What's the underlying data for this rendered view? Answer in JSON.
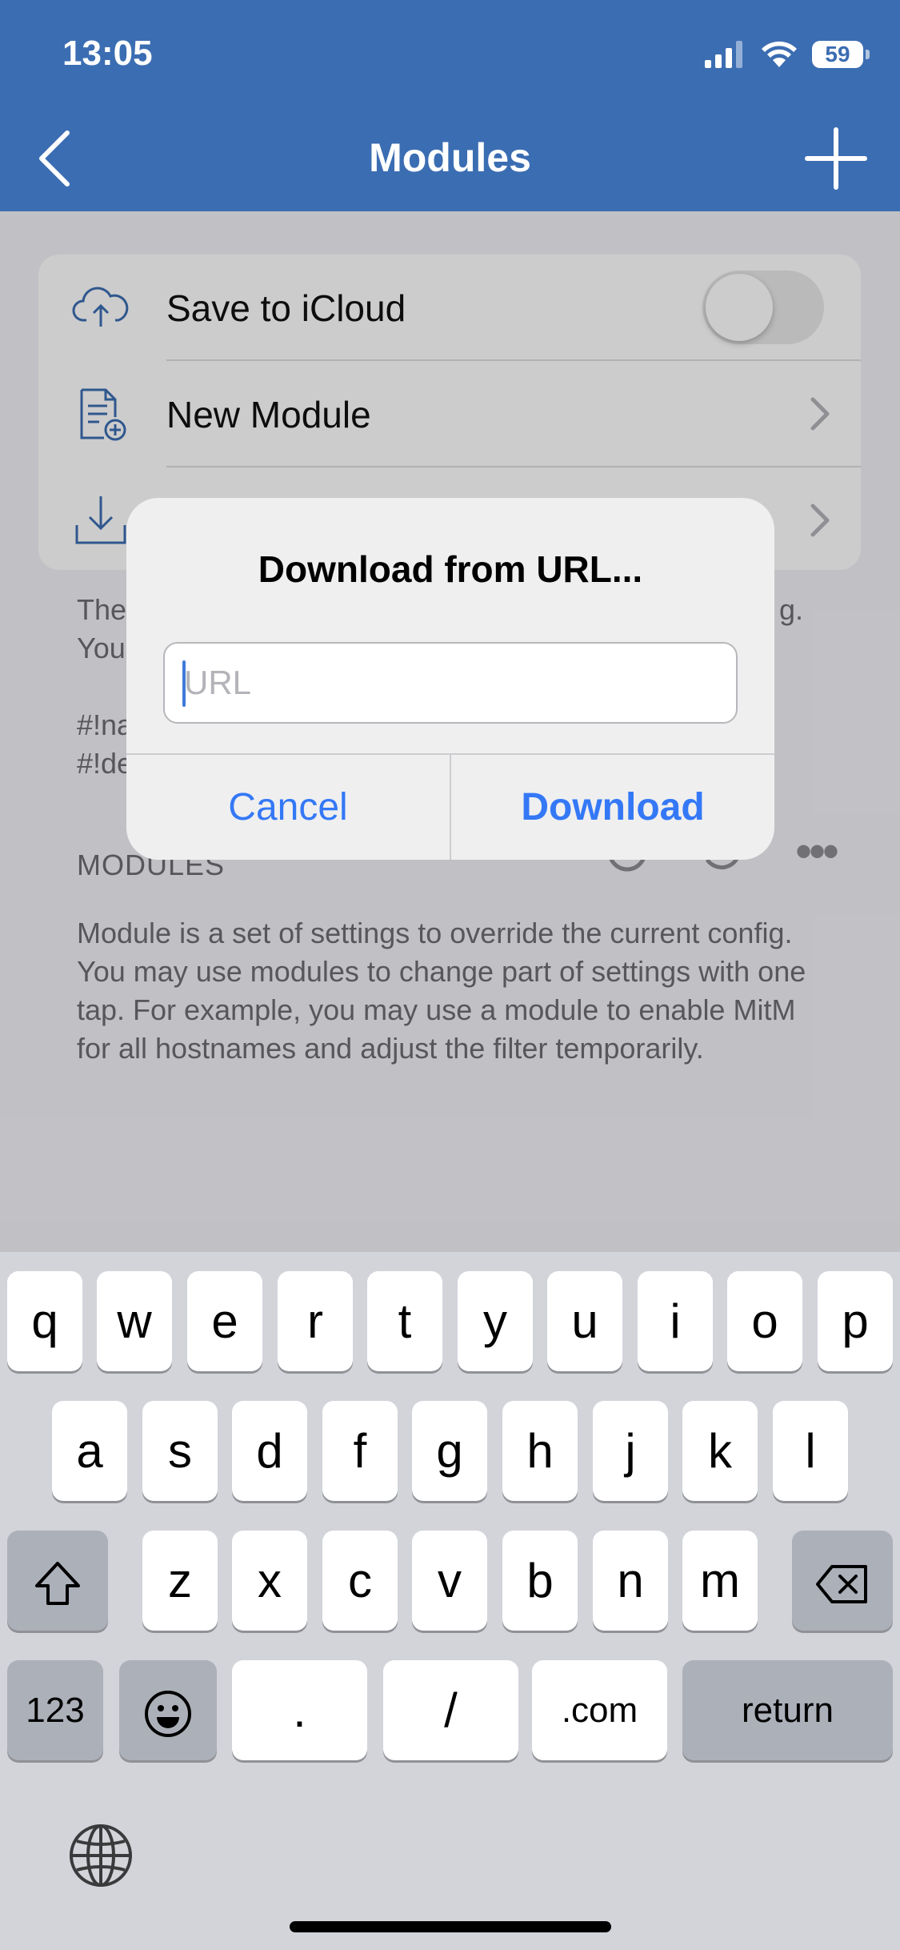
{
  "status_bar": {
    "time": "13:05",
    "battery": "59"
  },
  "nav": {
    "title": "Modules"
  },
  "settings": {
    "icloud_label": "Save to iCloud",
    "icloud_toggle": "off",
    "new_module_label": "New Module"
  },
  "background_text": {
    "desc_line1_start": "The",
    "desc_line1_end": "g.",
    "desc_line2_start": "You",
    "desc_line3": "#!na",
    "desc_line4": "#!de"
  },
  "modules_section": {
    "header": "MODULES",
    "more": "•••",
    "description": "Module is a set of settings to override the current config. You may use modules to change part of settings with one tap. For example, you may use a module to enable MitM for all hostnames and adjust the filter temporarily."
  },
  "alert": {
    "title": "Download from URL...",
    "url_value": "",
    "url_placeholder": "URL",
    "cancel_label": "Cancel",
    "download_label": "Download"
  },
  "keyboard": {
    "row1": [
      "q",
      "w",
      "e",
      "r",
      "t",
      "y",
      "u",
      "i",
      "o",
      "p"
    ],
    "row2": [
      "a",
      "s",
      "d",
      "f",
      "g",
      "h",
      "j",
      "k",
      "l"
    ],
    "row3": [
      "z",
      "x",
      "c",
      "v",
      "b",
      "n",
      "m"
    ],
    "numbers_key": "123",
    "dot_key": ".",
    "slash_key": "/",
    "dotcom_key": ".com",
    "return_key": "return"
  },
  "colors": {
    "nav_bar": "#3b6db2",
    "accent": "#3478f6"
  }
}
